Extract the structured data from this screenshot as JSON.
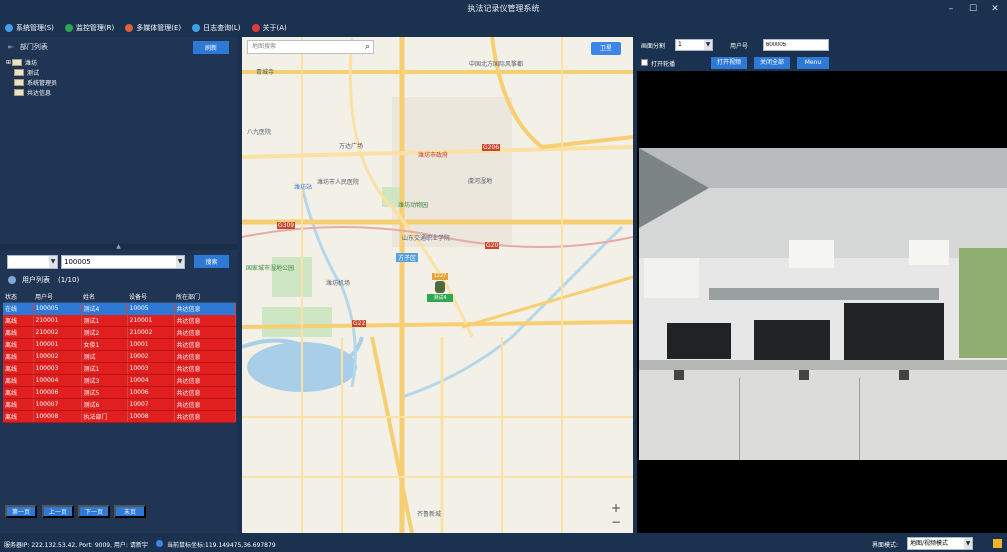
{
  "window": {
    "title": "执法记录仪管理系统"
  },
  "menu": [
    {
      "label": "系统管理(S)",
      "icon": "gear-icon",
      "color": "#3fa0e8"
    },
    {
      "label": "监控管理(R)",
      "icon": "monitor-icon",
      "color": "#2ea44f"
    },
    {
      "label": "多媒体管理(E)",
      "icon": "media-icon",
      "color": "#e0603a"
    },
    {
      "label": "日志查询(L)",
      "icon": "log-icon",
      "color": "#3fa0e8"
    },
    {
      "label": "关于(A)",
      "icon": "about-icon",
      "color": "#e33a3a"
    }
  ],
  "dept_panel": {
    "title": "部门列表",
    "refresh_label": "刷新",
    "tree": [
      "潍坊",
      "测试",
      "系统管理员",
      "共达信息"
    ]
  },
  "user_search": {
    "dept_value": "",
    "user_value": "100005",
    "search_label": "搜索"
  },
  "user_list": {
    "title": "用户列表",
    "count": "(1/10)",
    "columns": [
      "状态",
      "用户号",
      "姓名",
      "设备号",
      "所在部门"
    ],
    "rows": [
      {
        "status": "在线",
        "user_id": "100005",
        "name": "测试4",
        "device": "10005",
        "dept": "共达信息",
        "online": true
      },
      {
        "status": "离线",
        "user_id": "210001",
        "name": "测试1",
        "device": "210001",
        "dept": "共达信息",
        "online": false
      },
      {
        "status": "离线",
        "user_id": "210002",
        "name": "测试2",
        "device": "210002",
        "dept": "共达信息",
        "online": false
      },
      {
        "status": "离线",
        "user_id": "100001",
        "name": "女俊1",
        "device": "10001",
        "dept": "共达信息",
        "online": false
      },
      {
        "status": "离线",
        "user_id": "100002",
        "name": "测试",
        "device": "10002",
        "dept": "共达信息",
        "online": false
      },
      {
        "status": "离线",
        "user_id": "100003",
        "name": "测试1",
        "device": "10003",
        "dept": "共达信息",
        "online": false
      },
      {
        "status": "离线",
        "user_id": "100004",
        "name": "测试3",
        "device": "10004",
        "dept": "共达信息",
        "online": false
      },
      {
        "status": "离线",
        "user_id": "100006",
        "name": "测试5",
        "device": "10006",
        "dept": "共达信息",
        "online": false
      },
      {
        "status": "离线",
        "user_id": "100007",
        "name": "测试6",
        "device": "10007",
        "dept": "共达信息",
        "online": false
      },
      {
        "status": "离线",
        "user_id": "100008",
        "name": "执法部门",
        "device": "10008",
        "dept": "共达信息",
        "online": false
      }
    ]
  },
  "pager": [
    "第一页",
    "上一页",
    "下一页",
    "末页"
  ],
  "map": {
    "search_placeholder": "地图搜索",
    "satellite_label": "卫星",
    "zoom_in": "+",
    "zoom_out": "−",
    "marker_id": "1227",
    "marker_label": "测试4",
    "labels": [
      {
        "text": "青城寺",
        "pos": "tl"
      },
      {
        "text": "中国北方国际风筝都",
        "pos": "t"
      },
      {
        "text": "八九医院"
      },
      {
        "text": "万达广场"
      },
      {
        "text": "潍坊市政府"
      },
      {
        "text": "潍坊市人民医院"
      },
      {
        "text": "潍坊站"
      },
      {
        "text": "潍坊动物园"
      },
      {
        "text": "国家城市湿地公园"
      },
      {
        "text": "潍坊机场"
      },
      {
        "text": "山东交通职业学院"
      },
      {
        "text": "方子区"
      },
      {
        "text": "虞河湿地"
      },
      {
        "text": "齐鲁新城"
      }
    ],
    "roads": [
      "G309",
      "G206",
      "G20",
      "G22"
    ]
  },
  "right_panel": {
    "split_label": "画面分割",
    "split_value": "1",
    "user_label": "用户号",
    "user_value": "600005",
    "loop_label": "打开轮播",
    "open_video_label": "打开视频",
    "close_all_label": "关闭全部",
    "menu_label": "Menu"
  },
  "status": {
    "server": "服务器IP: 222.132.53.42,  Port: 9009,  用户: 请新宇",
    "coords": "当前鼠标坐标:119.149475,36.697879",
    "mode_label": "界面模式:",
    "mode_value": "地图/视频模式"
  }
}
